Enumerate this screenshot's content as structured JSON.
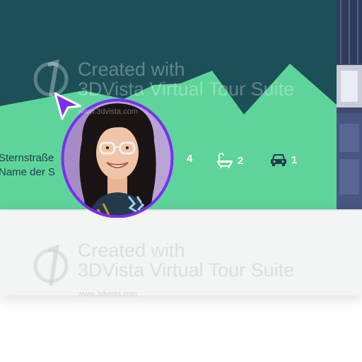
{
  "listing": {
    "address_line1": "Sternstraße",
    "address_line2": "Name der S"
  },
  "features": {
    "bedrooms": "4",
    "bathrooms": "2",
    "parking": "1"
  },
  "watermark": {
    "line1": "Created with",
    "line2": "3DVista Virtual Tour Suite",
    "url": "www.3dvista.com"
  },
  "colors": {
    "dark_teal": "#1d4f58",
    "mint": "#5ed49a",
    "accent_purple": "#7b2ff0",
    "address_text": "#1c3d4a"
  },
  "icons": [
    "bed-icon",
    "bath-icon",
    "car-icon",
    "cursor-icon",
    "3dvista-logo-icon"
  ]
}
